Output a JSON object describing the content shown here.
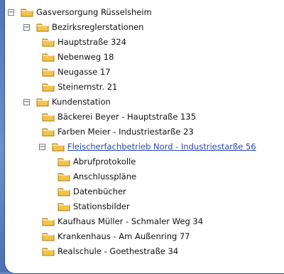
{
  "tree": {
    "items": [
      {
        "label": "Gasversorgung Rüsselsheim",
        "toggle": "−",
        "level": 0
      },
      {
        "label": "Bezirksreglerstationen",
        "toggle": "−",
        "level": 1
      },
      {
        "label": "Hauptstraße 324",
        "toggle": "",
        "level": 2
      },
      {
        "label": "Nebenweg 18",
        "toggle": "",
        "level": 2
      },
      {
        "label": "Neugasse 17",
        "toggle": "",
        "level": 2
      },
      {
        "label": "Steinernstr. 21",
        "toggle": "",
        "level": 2
      },
      {
        "label": "Kundenstation",
        "toggle": "−",
        "level": 1
      },
      {
        "label": "Bäckerei Beyer - Hauptstraße 135",
        "toggle": "",
        "level": 2
      },
      {
        "label": "Farben Meier - Industriestarße 23",
        "toggle": "",
        "level": 2
      },
      {
        "label": "Fleischerfachbetrieb Nord - Industriestarße 56",
        "toggle": "−",
        "level": 2,
        "link": true
      },
      {
        "label": "Abrufprotokolle",
        "toggle": "",
        "level": 3
      },
      {
        "label": "Anschlusspläne",
        "toggle": "",
        "level": 3
      },
      {
        "label": "Datenbücher",
        "toggle": "",
        "level": 3
      },
      {
        "label": "Stationsbilder",
        "toggle": "",
        "level": 3
      },
      {
        "label": "Kaufhaus Müller - Schmaler Weg 34",
        "toggle": "",
        "level": 2
      },
      {
        "label": "Krankenhaus - Am Außenring 77",
        "toggle": "",
        "level": 2
      },
      {
        "label": "Realschule - Goethestraße 34",
        "toggle": "",
        "level": 2
      }
    ]
  },
  "colors": {
    "frame": "#5f84c2",
    "folder_fill": "#f3c44a",
    "folder_stroke": "#a07a14",
    "link": "#2b48b0"
  }
}
